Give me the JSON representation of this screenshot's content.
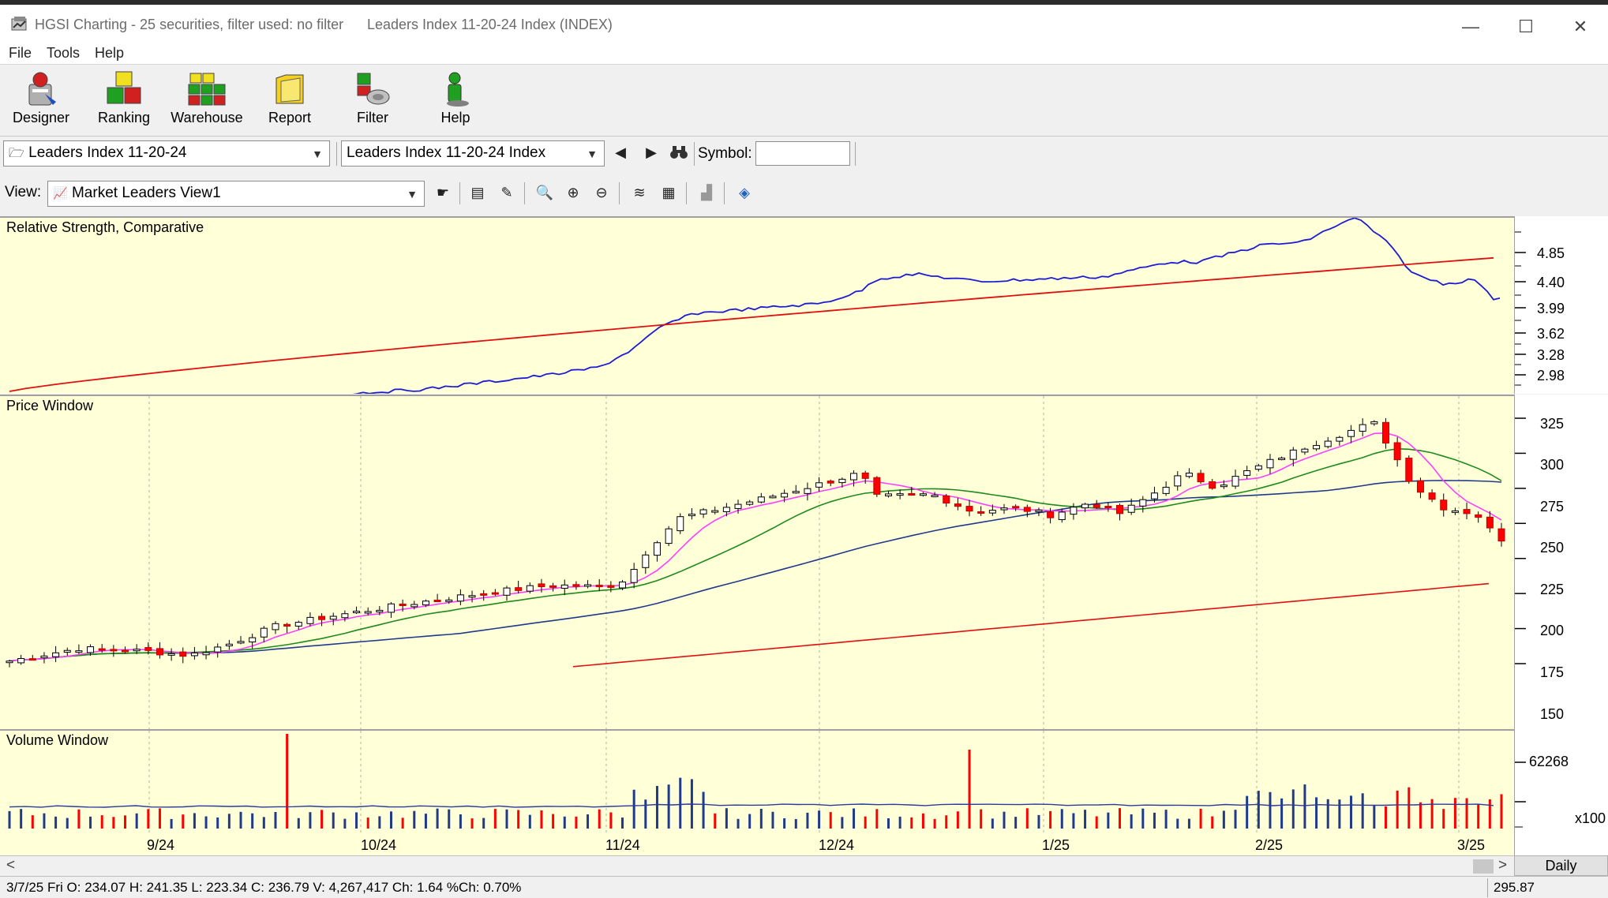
{
  "window": {
    "title": "HGSI Charting - 25 securities, filter used: no filter",
    "subtitle": "Leaders Index 11-20-24 Index (INDEX)",
    "minimize": "—",
    "maximize": "☐",
    "close": "✕"
  },
  "menu": [
    "File",
    "Tools",
    "Help"
  ],
  "toolbar": {
    "buttons": [
      {
        "label": "Designer",
        "icon": "designer-icon"
      },
      {
        "label": "Ranking",
        "icon": "ranking-icon"
      },
      {
        "label": "Warehouse",
        "icon": "warehouse-icon"
      },
      {
        "label": "Report",
        "icon": "report-icon"
      },
      {
        "label": "Filter",
        "icon": "filter-icon"
      },
      {
        "label": "Help",
        "icon": "help-icon"
      }
    ]
  },
  "selectors": {
    "list_combo": "Leaders Index 11-20-24",
    "security_combo": "Leaders Index 11-20-24 Index",
    "symbol_label": "Symbol:",
    "symbol_value": "",
    "view_label": "View:",
    "view_combo": "Market Leaders View1"
  },
  "colors": {
    "chart_bg": "#ffffd8",
    "up_candle": "#ffffff",
    "down_candle": "#ff0000",
    "rs_line": "#1c1cd0",
    "rs_ma": "#e01010",
    "ma_fast": "#ff40ff",
    "ma_mid": "#1e8a1e",
    "ma_slow": "#203a8a",
    "ma_long": "#e01010"
  },
  "rs_panel": {
    "title": "Relative Strength, Comparative",
    "axis_labels": [
      "4.85",
      "4.40",
      "3.99",
      "3.62",
      "3.28",
      "2.98"
    ]
  },
  "price_panel": {
    "title": "Price Window",
    "axis_labels": [
      "325",
      "300",
      "275",
      "250",
      "225",
      "200",
      "175",
      "150"
    ]
  },
  "volume_panel": {
    "title": "Volume Window",
    "axis_labels": [
      "62268"
    ],
    "multiplier": "x100"
  },
  "date_axis": [
    "9/24",
    "10/24",
    "11/24",
    "12/24",
    "1/25",
    "2/25",
    "3/25"
  ],
  "scroll": {
    "left_arrow": "<",
    "right_arrow": ">",
    "period": "Daily"
  },
  "status": {
    "left": "3/7/25 Fri O: 234.07 H: 241.35 L: 223.34 C: 236.79 V: 4,267,417 Ch: 1.64 %Ch: 0.70%",
    "right": "295.87"
  },
  "chart_data": {
    "type": "candlestick",
    "price_axis": {
      "ticks": [
        325,
        300,
        275,
        250,
        225,
        200,
        175,
        150
      ]
    },
    "rs_axis": {
      "ticks": [
        4.85,
        4.4,
        3.99,
        3.62,
        3.28,
        2.98
      ]
    },
    "month_labels": [
      "9/24",
      "10/24",
      "11/24",
      "12/24",
      "1/25",
      "2/25",
      "3/25"
    ],
    "last_bar": {
      "date": "3/7/25",
      "open": 234.07,
      "high": 241.35,
      "low": 223.34,
      "close": 236.79,
      "volume": 4267417
    }
  }
}
